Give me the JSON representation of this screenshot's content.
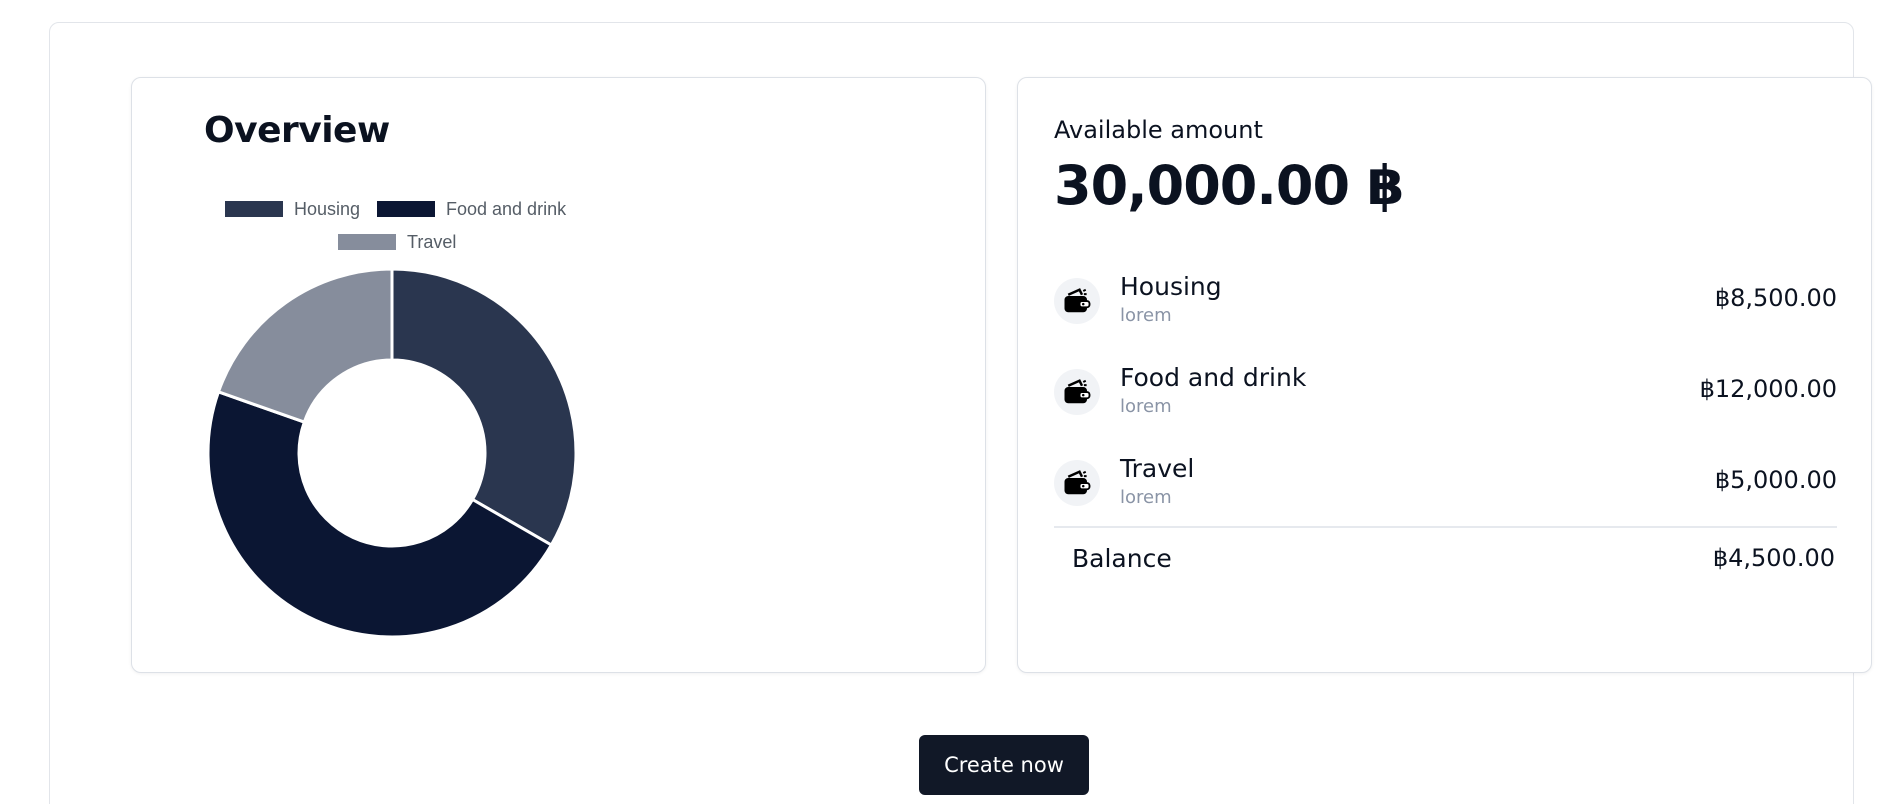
{
  "overview": {
    "title": "Overview",
    "legend": [
      {
        "label": "Housing",
        "color": "#2a364f"
      },
      {
        "label": "Food and drink",
        "color": "#0b1633"
      },
      {
        "label": "Travel",
        "color": "#868d9c"
      }
    ]
  },
  "chart_data": {
    "type": "pie",
    "donut": true,
    "categories": [
      "Housing",
      "Food and drink",
      "Travel"
    ],
    "values": [
      8500,
      12000,
      5000
    ],
    "colors": [
      "#2a364f",
      "#0b1633",
      "#868d9c"
    ],
    "legend_position": "top",
    "title": "Overview"
  },
  "summary": {
    "available_label": "Available amount",
    "available_amount": "30,000.00 ฿",
    "items": [
      {
        "name": "Housing",
        "sub": "lorem",
        "amount": "฿8,500.00",
        "icon": "wallet-icon"
      },
      {
        "name": "Food and drink",
        "sub": "lorem",
        "amount": "฿12,000.00",
        "icon": "wallet-icon"
      },
      {
        "name": "Travel",
        "sub": "lorem",
        "amount": "฿5,000.00",
        "icon": "wallet-icon"
      }
    ],
    "balance_label": "Balance",
    "balance_amount": "฿4,500.00"
  },
  "actions": {
    "create_label": "Create now"
  }
}
